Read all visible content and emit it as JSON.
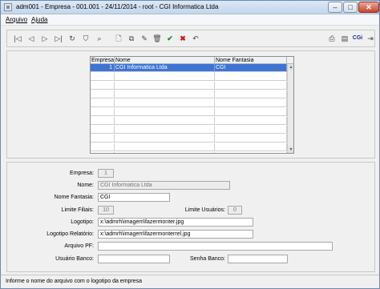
{
  "window": {
    "title": "adm001 - Empresa - 001.001 - 24/11/2014 - root - CGI Informatica Ltda",
    "min_glyph": "–",
    "max_glyph": "□",
    "close_glyph": "✕"
  },
  "menu": {
    "items": [
      "Arquivo",
      "Ajuda"
    ]
  },
  "toolbar": {
    "first": "|◁",
    "prev": "◁",
    "next": "▷",
    "last": "▷|",
    "refresh": "↻",
    "filter": "⛉",
    "search": "⌕",
    "new": "🗋",
    "copy": "⧉",
    "edit": "✎",
    "delete": "🗑",
    "confirm": "✔",
    "cancel": "✖",
    "undo": "↶",
    "print": "⎙",
    "books": "▤",
    "cgi": "CGi",
    "exit": "⇥"
  },
  "grid": {
    "columns": [
      "Empresa",
      "Nome",
      "Nome Fantasia"
    ],
    "rows": [
      {
        "empresa": "1",
        "nome": "CGI Informatica Ltda",
        "fantasia": "CGI",
        "selected": true
      }
    ],
    "empty_rows": 10
  },
  "form": {
    "empresa": {
      "label": "Empresa:",
      "value": "1"
    },
    "nome": {
      "label": "Nome:",
      "value": "CGI Informatica Ltda"
    },
    "nome_fantasia": {
      "label": "Nome Fantasia:",
      "value": "CGI"
    },
    "limite_filiais": {
      "label": "Limite Filiais:",
      "value": "10"
    },
    "limite_usuarios": {
      "label": "Limite Usuários:",
      "value": "0"
    },
    "logotipo": {
      "label": "Logotipo:",
      "value": "x:\\admrh\\imagem\\fazermonter.jpg"
    },
    "logotipo_relatorio": {
      "label": "Logotipo Relatório:",
      "value": "x:\\admrh\\imagem\\fazermonterrel.jpg"
    },
    "arquivo_pf": {
      "label": "Arquivo PF:",
      "value": ""
    },
    "usuario_banco": {
      "label": "Usuário Banco:",
      "value": ""
    },
    "senha_banco": {
      "label": "Senha Banco:",
      "value": ""
    }
  },
  "status": {
    "message": "Informe o nome do arquivo com o logotipo da empresa"
  },
  "colors": {
    "selection": "#3e74d4",
    "confirm": "#1c8b1c",
    "cancel": "#d21b1b",
    "brand": "#1a2b9c"
  }
}
